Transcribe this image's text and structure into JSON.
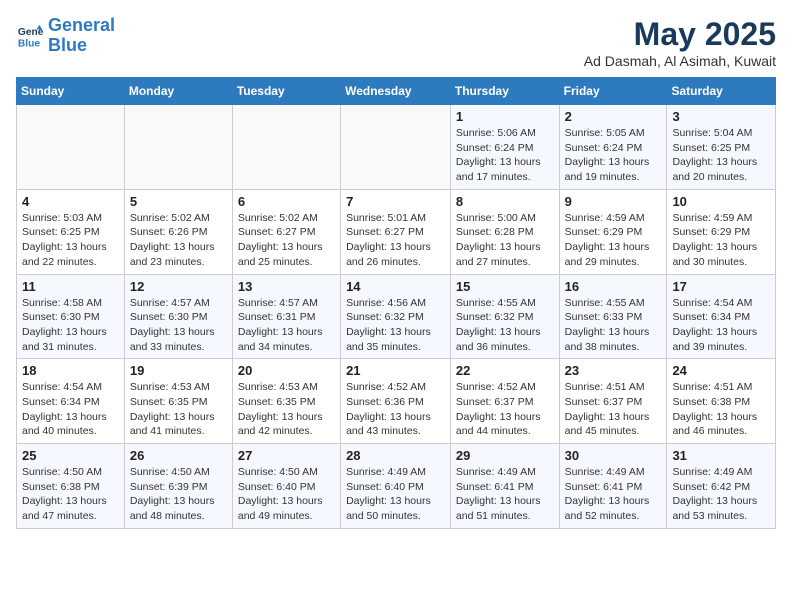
{
  "logo": {
    "line1": "General",
    "line2": "Blue"
  },
  "title": "May 2025",
  "location": "Ad Dasmah, Al Asimah, Kuwait",
  "headers": [
    "Sunday",
    "Monday",
    "Tuesday",
    "Wednesday",
    "Thursday",
    "Friday",
    "Saturday"
  ],
  "weeks": [
    [
      {
        "day": "",
        "detail": ""
      },
      {
        "day": "",
        "detail": ""
      },
      {
        "day": "",
        "detail": ""
      },
      {
        "day": "",
        "detail": ""
      },
      {
        "day": "1",
        "detail": "Sunrise: 5:06 AM\nSunset: 6:24 PM\nDaylight: 13 hours\nand 17 minutes."
      },
      {
        "day": "2",
        "detail": "Sunrise: 5:05 AM\nSunset: 6:24 PM\nDaylight: 13 hours\nand 19 minutes."
      },
      {
        "day": "3",
        "detail": "Sunrise: 5:04 AM\nSunset: 6:25 PM\nDaylight: 13 hours\nand 20 minutes."
      }
    ],
    [
      {
        "day": "4",
        "detail": "Sunrise: 5:03 AM\nSunset: 6:25 PM\nDaylight: 13 hours\nand 22 minutes."
      },
      {
        "day": "5",
        "detail": "Sunrise: 5:02 AM\nSunset: 6:26 PM\nDaylight: 13 hours\nand 23 minutes."
      },
      {
        "day": "6",
        "detail": "Sunrise: 5:02 AM\nSunset: 6:27 PM\nDaylight: 13 hours\nand 25 minutes."
      },
      {
        "day": "7",
        "detail": "Sunrise: 5:01 AM\nSunset: 6:27 PM\nDaylight: 13 hours\nand 26 minutes."
      },
      {
        "day": "8",
        "detail": "Sunrise: 5:00 AM\nSunset: 6:28 PM\nDaylight: 13 hours\nand 27 minutes."
      },
      {
        "day": "9",
        "detail": "Sunrise: 4:59 AM\nSunset: 6:29 PM\nDaylight: 13 hours\nand 29 minutes."
      },
      {
        "day": "10",
        "detail": "Sunrise: 4:59 AM\nSunset: 6:29 PM\nDaylight: 13 hours\nand 30 minutes."
      }
    ],
    [
      {
        "day": "11",
        "detail": "Sunrise: 4:58 AM\nSunset: 6:30 PM\nDaylight: 13 hours\nand 31 minutes."
      },
      {
        "day": "12",
        "detail": "Sunrise: 4:57 AM\nSunset: 6:30 PM\nDaylight: 13 hours\nand 33 minutes."
      },
      {
        "day": "13",
        "detail": "Sunrise: 4:57 AM\nSunset: 6:31 PM\nDaylight: 13 hours\nand 34 minutes."
      },
      {
        "day": "14",
        "detail": "Sunrise: 4:56 AM\nSunset: 6:32 PM\nDaylight: 13 hours\nand 35 minutes."
      },
      {
        "day": "15",
        "detail": "Sunrise: 4:55 AM\nSunset: 6:32 PM\nDaylight: 13 hours\nand 36 minutes."
      },
      {
        "day": "16",
        "detail": "Sunrise: 4:55 AM\nSunset: 6:33 PM\nDaylight: 13 hours\nand 38 minutes."
      },
      {
        "day": "17",
        "detail": "Sunrise: 4:54 AM\nSunset: 6:34 PM\nDaylight: 13 hours\nand 39 minutes."
      }
    ],
    [
      {
        "day": "18",
        "detail": "Sunrise: 4:54 AM\nSunset: 6:34 PM\nDaylight: 13 hours\nand 40 minutes."
      },
      {
        "day": "19",
        "detail": "Sunrise: 4:53 AM\nSunset: 6:35 PM\nDaylight: 13 hours\nand 41 minutes."
      },
      {
        "day": "20",
        "detail": "Sunrise: 4:53 AM\nSunset: 6:35 PM\nDaylight: 13 hours\nand 42 minutes."
      },
      {
        "day": "21",
        "detail": "Sunrise: 4:52 AM\nSunset: 6:36 PM\nDaylight: 13 hours\nand 43 minutes."
      },
      {
        "day": "22",
        "detail": "Sunrise: 4:52 AM\nSunset: 6:37 PM\nDaylight: 13 hours\nand 44 minutes."
      },
      {
        "day": "23",
        "detail": "Sunrise: 4:51 AM\nSunset: 6:37 PM\nDaylight: 13 hours\nand 45 minutes."
      },
      {
        "day": "24",
        "detail": "Sunrise: 4:51 AM\nSunset: 6:38 PM\nDaylight: 13 hours\nand 46 minutes."
      }
    ],
    [
      {
        "day": "25",
        "detail": "Sunrise: 4:50 AM\nSunset: 6:38 PM\nDaylight: 13 hours\nand 47 minutes."
      },
      {
        "day": "26",
        "detail": "Sunrise: 4:50 AM\nSunset: 6:39 PM\nDaylight: 13 hours\nand 48 minutes."
      },
      {
        "day": "27",
        "detail": "Sunrise: 4:50 AM\nSunset: 6:40 PM\nDaylight: 13 hours\nand 49 minutes."
      },
      {
        "day": "28",
        "detail": "Sunrise: 4:49 AM\nSunset: 6:40 PM\nDaylight: 13 hours\nand 50 minutes."
      },
      {
        "day": "29",
        "detail": "Sunrise: 4:49 AM\nSunset: 6:41 PM\nDaylight: 13 hours\nand 51 minutes."
      },
      {
        "day": "30",
        "detail": "Sunrise: 4:49 AM\nSunset: 6:41 PM\nDaylight: 13 hours\nand 52 minutes."
      },
      {
        "day": "31",
        "detail": "Sunrise: 4:49 AM\nSunset: 6:42 PM\nDaylight: 13 hours\nand 53 minutes."
      }
    ]
  ]
}
